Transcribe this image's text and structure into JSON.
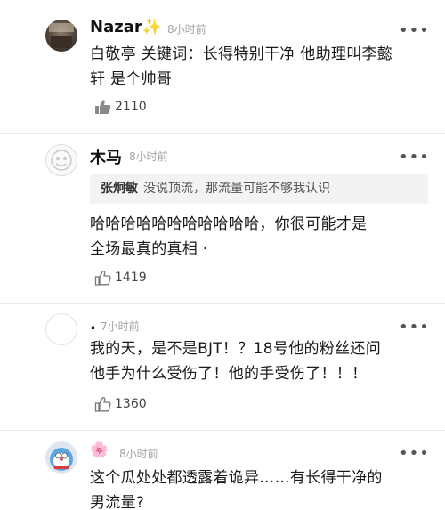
{
  "comments": [
    {
      "name": "Nazar",
      "emoji": "✨",
      "time": "8小时前",
      "line1": "白敬亭 关键词：长得特别干净 他助理叫李懿",
      "line2": "轩 是个帅哥",
      "likes": "2110"
    },
    {
      "name": "木马",
      "time": "8小时前",
      "quote_user": "张炯敏",
      "quote_text": "没说顶流，那流量可能不够我认识",
      "line1": "哈哈哈哈哈哈哈哈哈哈哈，你很可能才是",
      "line2": "全场最真的真相 ·",
      "likes": "1419"
    },
    {
      "name": ".",
      "time": "7小时前",
      "line1": "我的天，是不是BJT！？18号他的粉丝还问",
      "line2": "他手为什么受伤了！他的手受伤了！！！",
      "likes": "1360"
    },
    {
      "name": "🌸",
      "time": "8小时前",
      "line1": "这个瓜处处都透露着诡异……有长得干净的",
      "line2": "男流量?"
    }
  ],
  "more_label": "•••",
  "icons": {
    "like": "thumb-up-icon",
    "more": "more-dots-icon"
  }
}
